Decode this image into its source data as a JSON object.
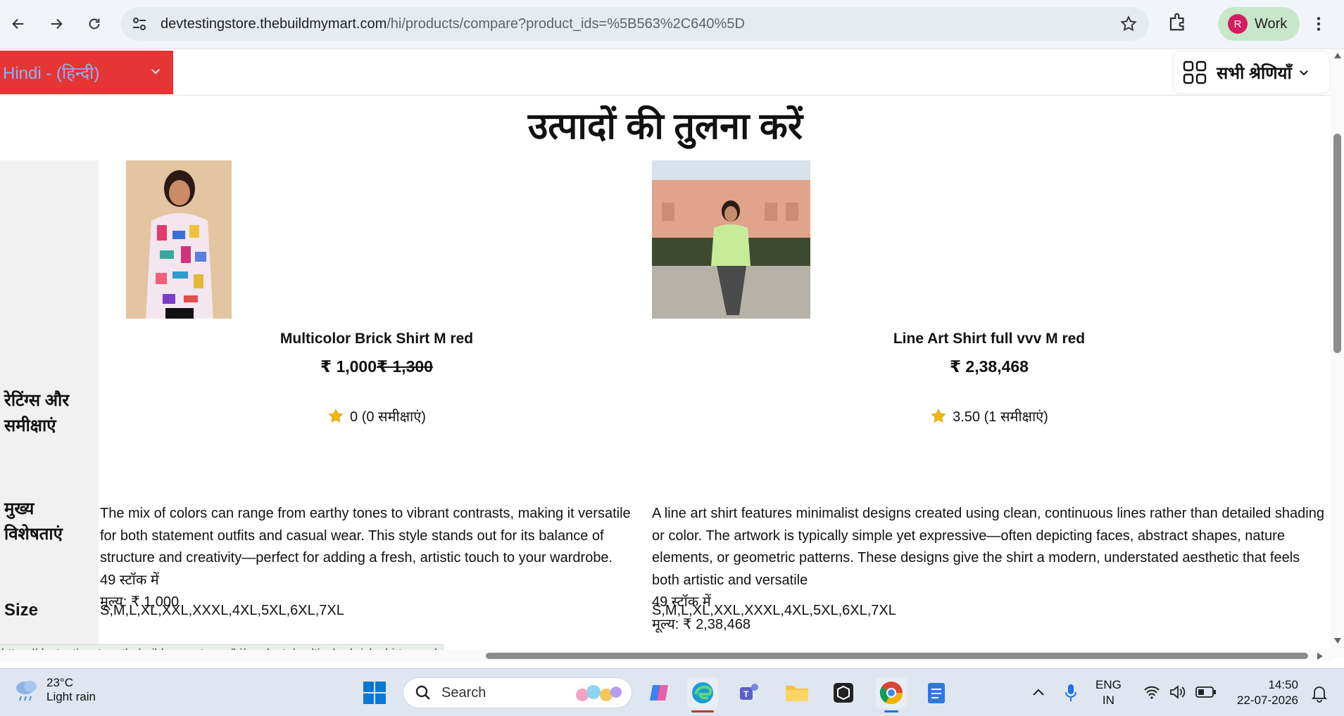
{
  "browser": {
    "url_host": "devtestingstore.thebuildmymart.com",
    "url_path": "/hi/products/compare?product_ids=%5B563%2C640%5D",
    "profile_initial": "R",
    "profile_label": "Work"
  },
  "header": {
    "language": "Hindi - (हिन्दी)",
    "categories_label": "सभी श्रेणियाँ"
  },
  "page_title": "उत्पादों की तुलना करें",
  "row_labels": {
    "ratings": "रेटिंग्स और समीक्षाएं",
    "features": "मुख्य विशेषताएं",
    "size": "Size"
  },
  "products": [
    {
      "name": "Multicolor Brick Shirt M red",
      "price": "₹ 1,000",
      "old_price": "₹ 1,300",
      "rating_text": "0 (0 समीक्षाएं)",
      "description": "The mix of colors can range from earthy tones to vibrant contrasts, making it versatile for both statement outfits and casual wear. This style stands out for its balance of structure and creativity—perfect for adding a fresh, artistic touch to your wardrobe.",
      "stock": "49 स्टॉक में",
      "price_line": "मूल्य: ₹ 1,000",
      "sizes": "S,M,L,XL,XXL,XXXL,4XL,5XL,6XL,7XL"
    },
    {
      "name": "Line Art Shirt full vvv M red",
      "price": "₹ 2,38,468",
      "old_price": "",
      "rating_text": "3.50 (1 समीक्षाएं)",
      "description": "A line art shirt features minimalist designs created using clean, continuous lines rather than detailed shading or color. The artwork is typically simple yet expressive—often depicting faces, abstract shapes, nature elements, or geometric patterns. These designs give the shirt a modern, understated aesthetic that feels both artistic and versatile",
      "stock": "49 स्टॉक में",
      "price_line": "मूल्य: ₹ 2,38,468",
      "sizes": "S,M,L,XL,XXL,XXXL,4XL,5XL,6XL,7XL"
    }
  ],
  "status_url": "https://devtestingstore.thebuildmymart.com/hi/products/multicolor-brick-shirt-m-red",
  "taskbar": {
    "temperature": "23°C",
    "weather": "Light rain",
    "search_label": "Search",
    "lang_top": "ENG",
    "lang_bottom": "IN",
    "time": "14:50",
    "date": "22-07-2026"
  },
  "colors": {
    "language_bg": "#e53535",
    "language_text": "#8ab4f8",
    "star": "#f5b800"
  }
}
